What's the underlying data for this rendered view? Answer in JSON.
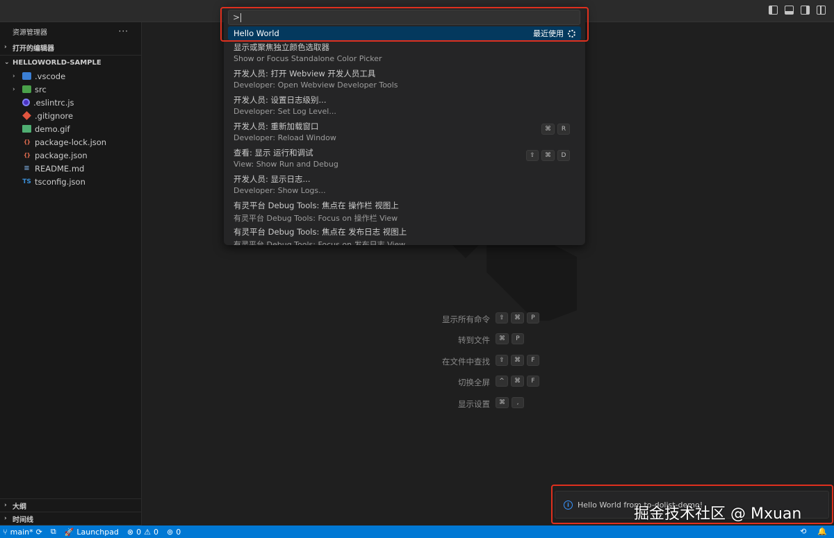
{
  "titlebar": {
    "layout_icons": [
      "toggle-primary-sidebar-icon",
      "toggle-panel-icon",
      "toggle-secondary-sidebar-icon",
      "customize-layout-icon"
    ]
  },
  "sidebar": {
    "title": "资源管理器",
    "more": "···",
    "open_editors": "打开的编辑器",
    "project": "HELLOWORLD-SAMPLE",
    "files": [
      {
        "name": ".vscode",
        "folder": true,
        "icon": "vscode-folder-icon"
      },
      {
        "name": "src",
        "folder": true,
        "icon": "src-folder-icon"
      },
      {
        "name": ".eslintrc.js",
        "folder": false,
        "icon": "eslint-icon"
      },
      {
        "name": ".gitignore",
        "folder": false,
        "icon": "git-icon"
      },
      {
        "name": "demo.gif",
        "folder": false,
        "icon": "image-icon"
      },
      {
        "name": "package-lock.json",
        "folder": false,
        "icon": "json-icon"
      },
      {
        "name": "package.json",
        "folder": false,
        "icon": "json-icon"
      },
      {
        "name": "README.md",
        "folder": false,
        "icon": "markdown-icon"
      },
      {
        "name": "tsconfig.json",
        "folder": false,
        "icon": "tsconfig-icon"
      }
    ],
    "outline": "大纲",
    "timeline": "时间线"
  },
  "palette": {
    "input_value": ">",
    "selected": {
      "title": "Hello World",
      "meta": "最近使用"
    },
    "results": [
      {
        "title": "显示或聚焦独立颜色选取器",
        "sub": "Show or Focus Standalone Color Picker",
        "keys": []
      },
      {
        "title": "开发人员: 打开 Webview 开发人员工具",
        "sub": "Developer: Open Webview Developer Tools",
        "keys": []
      },
      {
        "title": "开发人员: 设置日志级别...",
        "sub": "Developer: Set Log Level...",
        "keys": []
      },
      {
        "title": "开发人员: 重新加载窗口",
        "sub": "Developer: Reload Window",
        "keys": [
          "⌘",
          "R"
        ]
      },
      {
        "title": "查看: 显示 运行和调试",
        "sub": "View: Show Run and Debug",
        "keys": [
          "⇧",
          "⌘",
          "D"
        ]
      },
      {
        "title": "开发人员: 显示日志...",
        "sub": "Developer: Show Logs...",
        "keys": []
      },
      {
        "title": "有灵平台 Debug Tools: 焦点在 操作栏 视图上",
        "sub": "有灵平台 Debug Tools: Focus on 操作栏 View",
        "keys": []
      },
      {
        "title": "有灵平台 Debug Tools: 焦点在 发布日志 视图上",
        "sub": "有灵平台 Debug Tools: Focus on 发布日志 View",
        "keys": []
      }
    ]
  },
  "shortcuts": [
    {
      "label": "显示所有命令",
      "keys": [
        "⇧",
        "⌘",
        "P"
      ]
    },
    {
      "label": "转到文件",
      "keys": [
        "⌘",
        "P"
      ]
    },
    {
      "label": "在文件中查找",
      "keys": [
        "⇧",
        "⌘",
        "F"
      ]
    },
    {
      "label": "切换全屏",
      "keys": [
        "^",
        "⌘",
        "F"
      ]
    },
    {
      "label": "显示设置",
      "keys": [
        "⌘",
        ","
      ]
    }
  ],
  "notification": {
    "text": "Hello World from to-dolist-demo!"
  },
  "credit": "掘金技术社区 @ Mxuan",
  "statusbar": {
    "branch": "main*",
    "launchpad": "Launchpad",
    "errors": "0",
    "warnings": "0",
    "ports": "0"
  }
}
